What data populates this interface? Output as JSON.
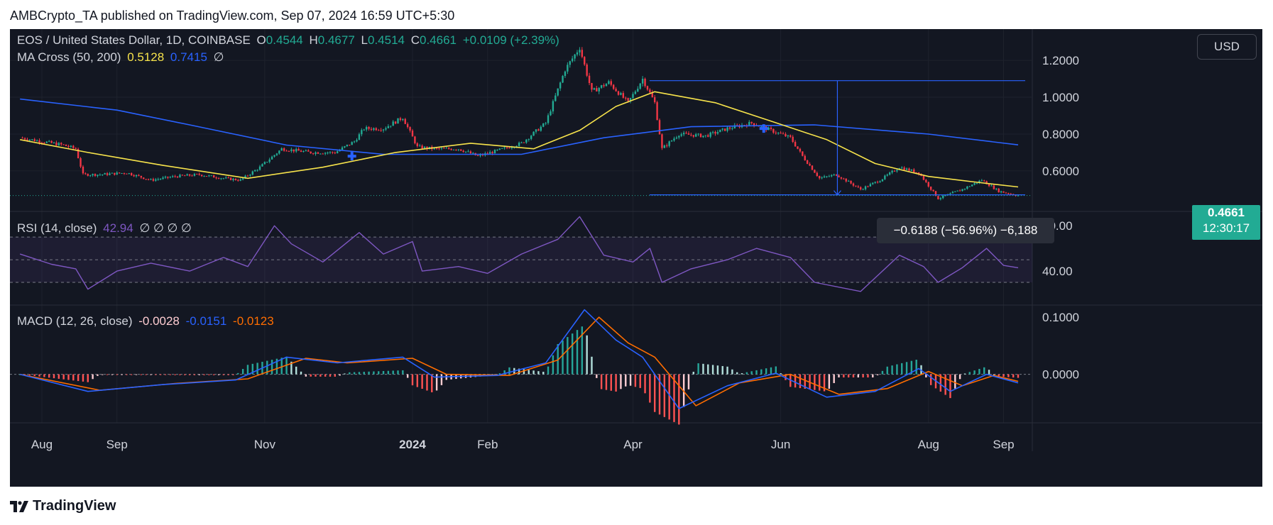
{
  "header": {
    "published": "AMBCrypto_TA published on TradingView.com, Sep 07, 2024 16:59 UTC+5:30"
  },
  "legend": {
    "symbol": "EOS / United States Dollar, 1D, COINBASE",
    "o_label": "O",
    "o": "0.4544",
    "h_label": "H",
    "h": "0.4677",
    "l_label": "L",
    "l": "0.4514",
    "c_label": "C",
    "c": "0.4661",
    "change": "+0.0109 (+2.39%)",
    "ma_title": "MA Cross (50, 200)",
    "ma_fast": "0.5128",
    "ma_slow": "0.7415",
    "ma_extra": "∅",
    "rsi_title": "RSI (14, close)",
    "rsi_value": "42.94",
    "rsi_extra": "∅ ∅ ∅ ∅",
    "macd_title": "MACD (12, 26, close)",
    "macd_hist": "-0.0028",
    "macd_line": "-0.0151",
    "macd_signal": "-0.0123"
  },
  "currency_button": "USD",
  "price_tag": {
    "price": "0.4661",
    "countdown": "12:30:17"
  },
  "measure": {
    "text": "−0.6188 (−56.96%) −6,188"
  },
  "brand": {
    "name": "TradingView"
  },
  "colors": {
    "background": "#131722",
    "grid": "#1e222d",
    "up": "#22ab94",
    "down": "#f23645",
    "ma_fast": "#f7e34b",
    "ma_slow": "#2962ff",
    "rsi": "#7e57c2",
    "macd": "#2962ff",
    "signal": "#ff6d00",
    "text": "#d1d4dc"
  },
  "chart_data": [
    {
      "type": "candlestick",
      "title": "EOS / United States Dollar, 1D, COINBASE",
      "y_ticks": [
        "1.2000",
        "1.0000",
        "0.8000",
        "0.6000"
      ],
      "ylim": [
        0.38,
        1.37
      ],
      "x_ticks": [
        "Aug",
        "Sep",
        "Nov",
        "2024",
        "Feb",
        "Apr",
        "Jun",
        "Aug",
        "Sep"
      ],
      "close_path": [
        [
          "2023-07-23",
          0.78
        ],
        [
          "2023-08-01",
          0.76
        ],
        [
          "2023-08-10",
          0.74
        ],
        [
          "2023-08-15",
          0.72
        ],
        [
          "2023-08-18",
          0.58
        ],
        [
          "2023-08-25",
          0.58
        ],
        [
          "2023-09-05",
          0.59
        ],
        [
          "2023-09-15",
          0.55
        ],
        [
          "2023-09-25",
          0.57
        ],
        [
          "2023-10-05",
          0.58
        ],
        [
          "2023-10-15",
          0.56
        ],
        [
          "2023-10-22",
          0.55
        ],
        [
          "2023-10-30",
          0.62
        ],
        [
          "2023-11-08",
          0.72
        ],
        [
          "2023-11-20",
          0.7
        ],
        [
          "2023-11-30",
          0.7
        ],
        [
          "2023-12-08",
          0.76
        ],
        [
          "2023-12-12",
          0.83
        ],
        [
          "2023-12-20",
          0.83
        ],
        [
          "2023-12-28",
          0.89
        ],
        [
          "2024-01-03",
          0.73
        ],
        [
          "2024-01-10",
          0.72
        ],
        [
          "2024-01-20",
          0.72
        ],
        [
          "2024-01-28",
          0.68
        ],
        [
          "2024-02-05",
          0.71
        ],
        [
          "2024-02-15",
          0.75
        ],
        [
          "2024-02-25",
          0.86
        ],
        [
          "2024-03-04",
          1.15
        ],
        [
          "2024-03-10",
          1.27
        ],
        [
          "2024-03-15",
          1.03
        ],
        [
          "2024-03-22",
          1.08
        ],
        [
          "2024-03-30",
          0.97
        ],
        [
          "2024-04-05",
          1.1
        ],
        [
          "2024-04-10",
          0.97
        ],
        [
          "2024-04-13",
          0.72
        ],
        [
          "2024-04-20",
          0.8
        ],
        [
          "2024-05-01",
          0.79
        ],
        [
          "2024-05-10",
          0.83
        ],
        [
          "2024-05-20",
          0.86
        ],
        [
          "2024-05-28",
          0.82
        ],
        [
          "2024-06-05",
          0.78
        ],
        [
          "2024-06-10",
          0.68
        ],
        [
          "2024-06-17",
          0.56
        ],
        [
          "2024-06-24",
          0.58
        ],
        [
          "2024-07-04",
          0.5
        ],
        [
          "2024-07-12",
          0.55
        ],
        [
          "2024-07-20",
          0.62
        ],
        [
          "2024-07-28",
          0.59
        ],
        [
          "2024-08-05",
          0.45
        ],
        [
          "2024-08-15",
          0.5
        ],
        [
          "2024-08-23",
          0.55
        ],
        [
          "2024-08-30",
          0.49
        ],
        [
          "2024-09-07",
          0.4661
        ]
      ],
      "ma_50_path": [
        [
          "2023-07-23",
          0.77
        ],
        [
          "2023-08-20",
          0.7
        ],
        [
          "2023-09-20",
          0.63
        ],
        [
          "2023-10-25",
          0.56
        ],
        [
          "2023-11-25",
          0.62
        ],
        [
          "2023-12-25",
          0.7
        ],
        [
          "2024-01-25",
          0.75
        ],
        [
          "2024-02-20",
          0.72
        ],
        [
          "2024-03-10",
          0.82
        ],
        [
          "2024-03-25",
          0.95
        ],
        [
          "2024-04-10",
          1.03
        ],
        [
          "2024-05-05",
          0.97
        ],
        [
          "2024-05-28",
          0.87
        ],
        [
          "2024-06-20",
          0.77
        ],
        [
          "2024-07-10",
          0.64
        ],
        [
          "2024-08-01",
          0.57
        ],
        [
          "2024-08-20",
          0.54
        ],
        [
          "2024-09-07",
          0.5128
        ]
      ],
      "ma_200_path": [
        [
          "2023-07-23",
          0.99
        ],
        [
          "2023-09-01",
          0.93
        ],
        [
          "2023-10-01",
          0.85
        ],
        [
          "2023-11-10",
          0.74
        ],
        [
          "2023-12-20",
          0.69
        ],
        [
          "2024-02-15",
          0.69
        ],
        [
          "2024-03-20",
          0.78
        ],
        [
          "2024-04-25",
          0.84
        ],
        [
          "2024-06-15",
          0.85
        ],
        [
          "2024-08-01",
          0.8
        ],
        [
          "2024-09-07",
          0.7415
        ]
      ],
      "cross_markers": [
        [
          "2023-12-07",
          0.68
        ],
        [
          "2024-05-25",
          0.83
        ]
      ],
      "measure": {
        "from": [
          "2024-04-02",
          1.09
        ],
        "to": [
          "2024-09-07",
          0.47
        ],
        "change": -0.6188,
        "percent": -56.96,
        "ticks": -6188
      }
    },
    {
      "type": "line",
      "title": "RSI (14, close)",
      "y_ticks": [
        "80.00",
        "40.00"
      ],
      "bands": [
        70,
        30
      ],
      "mid": 50,
      "ylim": [
        10,
        92
      ],
      "series": [
        {
          "name": "RSI",
          "values": [
            [
              "2023-07-23",
              55
            ],
            [
              "2023-08-05",
              46
            ],
            [
              "2023-08-15",
              42
            ],
            [
              "2023-08-20",
              24
            ],
            [
              "2023-09-01",
              40
            ],
            [
              "2023-09-15",
              47
            ],
            [
              "2023-10-01",
              40
            ],
            [
              "2023-10-15",
              52
            ],
            [
              "2023-10-25",
              44
            ],
            [
              "2023-11-05",
              80
            ],
            [
              "2023-11-12",
              64
            ],
            [
              "2023-11-25",
              48
            ],
            [
              "2023-12-10",
              74
            ],
            [
              "2023-12-20",
              55
            ],
            [
              "2024-01-01",
              66
            ],
            [
              "2024-01-05",
              40
            ],
            [
              "2024-01-20",
              44
            ],
            [
              "2024-02-01",
              38
            ],
            [
              "2024-02-15",
              55
            ],
            [
              "2024-03-01",
              68
            ],
            [
              "2024-03-10",
              88
            ],
            [
              "2024-03-20",
              54
            ],
            [
              "2024-04-01",
              48
            ],
            [
              "2024-04-08",
              60
            ],
            [
              "2024-04-13",
              30
            ],
            [
              "2024-04-25",
              42
            ],
            [
              "2024-05-10",
              50
            ],
            [
              "2024-05-22",
              60
            ],
            [
              "2024-06-05",
              52
            ],
            [
              "2024-06-15",
              30
            ],
            [
              "2024-07-04",
              22
            ],
            [
              "2024-07-20",
              54
            ],
            [
              "2024-07-30",
              44
            ],
            [
              "2024-08-05",
              30
            ],
            [
              "2024-08-15",
              43
            ],
            [
              "2024-08-25",
              60
            ],
            [
              "2024-09-01",
              45
            ],
            [
              "2024-09-07",
              42.94
            ]
          ]
        }
      ]
    },
    {
      "type": "line",
      "title": "MACD (12, 26, close)",
      "y_ticks": [
        "0.1000",
        "0.0000"
      ],
      "ylim": [
        -0.085,
        0.12
      ],
      "series": [
        {
          "name": "MACD",
          "values": [
            [
              "2023-07-23",
              0.0
            ],
            [
              "2023-08-20",
              -0.03
            ],
            [
              "2023-09-20",
              -0.018
            ],
            [
              "2023-10-20",
              -0.01
            ],
            [
              "2023-11-10",
              0.03
            ],
            [
              "2023-12-01",
              0.02
            ],
            [
              "2023-12-28",
              0.03
            ],
            [
              "2024-01-10",
              -0.005
            ],
            [
              "2024-02-05",
              -0.002
            ],
            [
              "2024-02-25",
              0.02
            ],
            [
              "2024-03-12",
              0.113
            ],
            [
              "2024-03-25",
              0.06
            ],
            [
              "2024-04-05",
              0.03
            ],
            [
              "2024-04-20",
              -0.06
            ],
            [
              "2024-05-10",
              -0.02
            ],
            [
              "2024-05-30",
              0.002
            ],
            [
              "2024-06-20",
              -0.04
            ],
            [
              "2024-07-10",
              -0.03
            ],
            [
              "2024-07-28",
              0.01
            ],
            [
              "2024-08-10",
              -0.03
            ],
            [
              "2024-08-25",
              0.0
            ],
            [
              "2024-09-07",
              -0.0151
            ]
          ]
        },
        {
          "name": "Signal",
          "values": [
            [
              "2023-07-23",
              0.0
            ],
            [
              "2023-08-25",
              -0.028
            ],
            [
              "2023-09-25",
              -0.016
            ],
            [
              "2023-10-25",
              -0.008
            ],
            [
              "2023-11-18",
              0.028
            ],
            [
              "2023-12-05",
              0.02
            ],
            [
              "2024-01-01",
              0.028
            ],
            [
              "2024-01-15",
              0.0
            ],
            [
              "2024-02-10",
              -0.002
            ],
            [
              "2024-03-01",
              0.025
            ],
            [
              "2024-03-18",
              0.1
            ],
            [
              "2024-03-30",
              0.055
            ],
            [
              "2024-04-10",
              0.03
            ],
            [
              "2024-04-27",
              -0.055
            ],
            [
              "2024-05-15",
              -0.015
            ],
            [
              "2024-06-05",
              0.0
            ],
            [
              "2024-06-25",
              -0.035
            ],
            [
              "2024-07-15",
              -0.025
            ],
            [
              "2024-08-01",
              0.005
            ],
            [
              "2024-08-15",
              -0.02
            ],
            [
              "2024-08-28",
              -0.002
            ],
            [
              "2024-09-07",
              -0.0123
            ]
          ]
        }
      ]
    }
  ]
}
